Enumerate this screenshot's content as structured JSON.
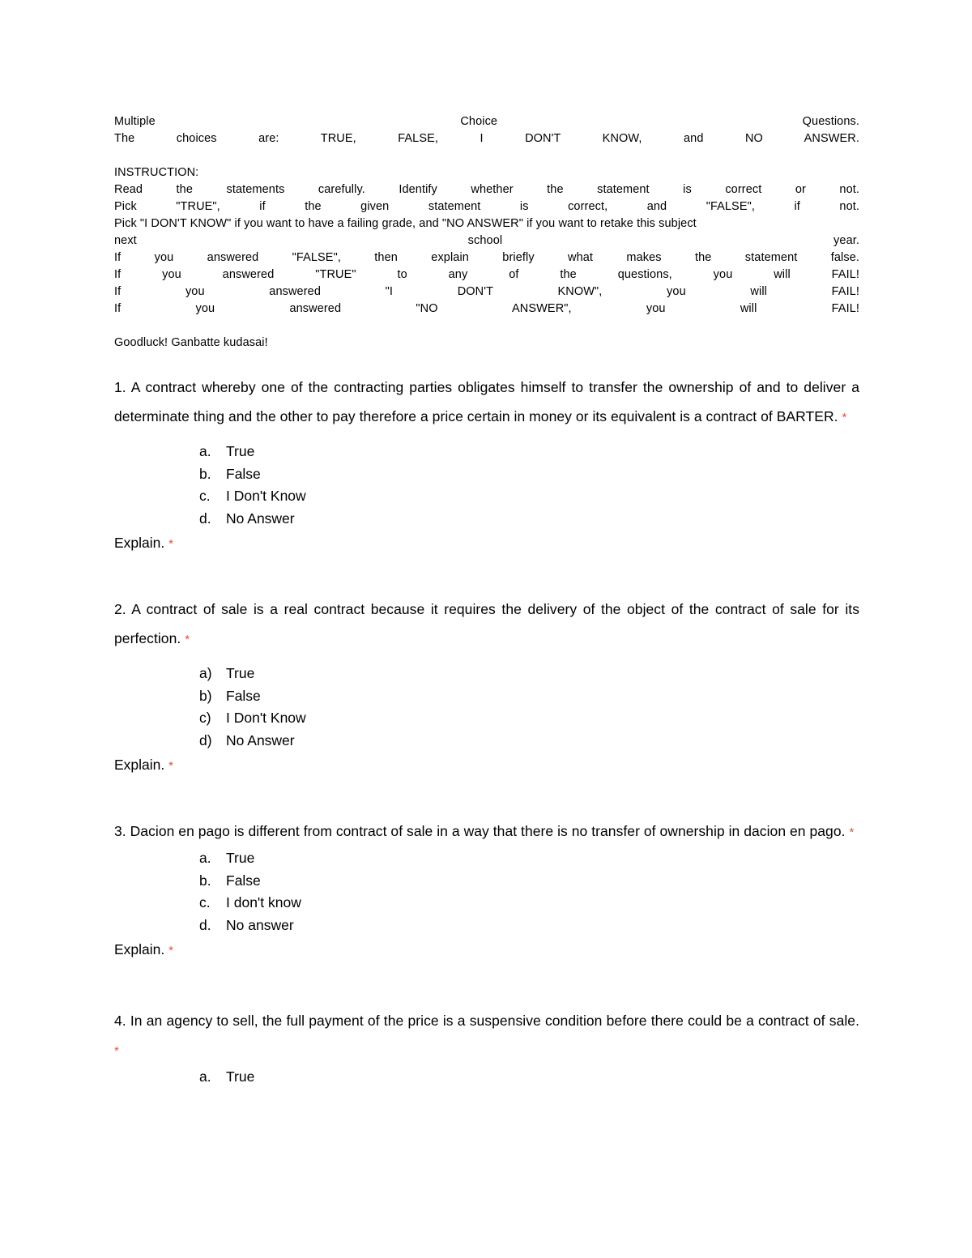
{
  "document": {
    "header": {
      "title_line": "Multiple Choice Questions.",
      "choices_line": "The choices are: TRUE, FALSE, I DON'T KNOW, and NO ANSWER.",
      "instruction_label": "INSTRUCTION:",
      "instruction_lines": [
        "Read the statements carefully. Identify whether the statement is correct or not.",
        "Pick \"TRUE\", if the given statement is correct, and \"FALSE\", if not.",
        "Pick \"I DON'T KNOW\" if you want to have a failing grade, and \"NO ANSWER\" if you want to retake this subject",
        "next school year.",
        "If you answered \"FALSE\", then explain briefly what makes the statement false.",
        "If you answered \"TRUE\" to any of the questions, you will FAIL!",
        "If you answered \"I DON'T KNOW\", you will FAIL!",
        "If you answered \"NO ANSWER\", you will FAIL!"
      ],
      "goodluck": "Goodluck! Ganbatte kudasai!"
    },
    "required_marker": "*",
    "required_color": "#e0533a",
    "explain_label": "Explain.",
    "questions": [
      {
        "number": "1.",
        "text": "1. A contract whereby one of the contracting parties obligates himself to transfer the ownership of and to deliver a determinate thing and the other to pay therefore a price certain in money or its equivalent is a contract of BARTER.",
        "options": [
          {
            "marker": "a.",
            "label": "True"
          },
          {
            "marker": "b.",
            "label": "False"
          },
          {
            "marker": "c.",
            "label": "I Don't Know"
          },
          {
            "marker": "d.",
            "label": "No Answer"
          }
        ],
        "has_explain": true
      },
      {
        "number": "2.",
        "text": "2. A contract of sale is a real contract because it requires the delivery of the object of the contract of sale for its perfection.",
        "options": [
          {
            "marker": "a)",
            "label": "True"
          },
          {
            "marker": "b)",
            "label": "False"
          },
          {
            "marker": "c)",
            "label": "I Don't Know"
          },
          {
            "marker": "d)",
            "label": "No Answer"
          }
        ],
        "has_explain": true
      },
      {
        "number": "3.",
        "text": "3. Dacion en pago is different from contract of sale in a way that there is no transfer of ownership in dacion en pago.",
        "options": [
          {
            "marker": "a.",
            "label": "True"
          },
          {
            "marker": "b.",
            "label": "False"
          },
          {
            "marker": "c.",
            "label": "I don't know"
          },
          {
            "marker": "d.",
            "label": "No answer"
          }
        ],
        "has_explain": true
      },
      {
        "number": "4.",
        "text": "4. In an agency to sell, the full payment of the price is a suspensive condition before there could be a contract of sale.",
        "options": [
          {
            "marker": "a.",
            "label": "True"
          }
        ],
        "has_explain": false
      }
    ]
  }
}
